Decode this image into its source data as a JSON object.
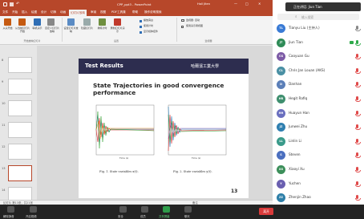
{
  "window": {
    "title": "CPP_ppt3 - PowerPoint",
    "user": "Hall Jiten",
    "share_badge": "正在讲话: Jiun Tian"
  },
  "ribbon": {
    "tabs": [
      "文件",
      "开始",
      "插入",
      "绘图",
      "设计",
      "切换",
      "动画",
      "幻灯片放映",
      "审阅",
      "视图",
      "PDF工具集",
      "帮助",
      "操作说明搜索"
    ],
    "active_tab": "幻灯片放映",
    "buttons": [
      "从头开始",
      "从当前幻灯片开始",
      "联机演示",
      "自定义幻灯片放映",
      "设置幻灯片放映",
      "隐藏幻灯片",
      "排练计时",
      "录制幻灯片演示"
    ],
    "checkboxes": [
      "播放旁白",
      "使用计时",
      "显示媒体控件"
    ],
    "monitor_label": "监视器: 自动",
    "presenter_view": "使用演示者视图",
    "groups": [
      "开始放映幻灯片",
      "设置",
      "监视器"
    ]
  },
  "thumbnails": [
    "8",
    "9",
    "10",
    "11",
    "12",
    "13",
    "14"
  ],
  "slide": {
    "header": "Test Results",
    "university": "哈爾濱工業大學",
    "title": "State Trajectories in good convergence performance",
    "caption1": "Fig. 1. State variables x(t).",
    "caption2": "Fig. 2. State variables y(t).",
    "axis_label1": "Time (s)",
    "axis_label2": "Time (s)",
    "page_number": "13"
  },
  "statusbar": {
    "left": "幻灯片 第13张，共21张",
    "right": "备注"
  },
  "sidebar": {
    "search_placeholder": "输入搜索",
    "participants": [
      {
        "initials": "TL",
        "name": "Tianyu Liu (主持人)",
        "color": "#3a7bd5",
        "mic": "on"
      },
      {
        "initials": "JT",
        "name": "Jiun Tian",
        "color": "#2e8b57",
        "mic": "active"
      },
      {
        "initials": "CG",
        "name": "Caoyuan Gu",
        "color": "#7d5ba6",
        "mic": "off"
      },
      {
        "initials": "CL",
        "name": "Chris Jan Louan (AKS)",
        "color": "#4a90a4",
        "mic": "off"
      },
      {
        "initials": "D",
        "name": "Danhan",
        "color": "#5b7fb8",
        "mic": "off"
      },
      {
        "initials": "HR",
        "name": "Hegit Rafiq",
        "color": "#3f8f6f",
        "mic": "off"
      },
      {
        "initials": "HH",
        "name": "Huayun Han",
        "color": "#6a6fbf",
        "mic": "off"
      },
      {
        "initials": "JZ",
        "name": "Junwei Zhu",
        "color": "#2f7fb0",
        "mic": "off"
      },
      {
        "initials": "LL",
        "name": "Linlin Li",
        "color": "#3a9a8a",
        "mic": "off"
      },
      {
        "initials": "S",
        "name": "Steven",
        "color": "#4b6fbf",
        "mic": "off"
      },
      {
        "initials": "XX",
        "name": "Xiaoyi Xu",
        "color": "#3c8f5a",
        "mic": "off"
      },
      {
        "initials": "Y",
        "name": "Yuchen",
        "color": "#6a5fb0",
        "mic": "off"
      },
      {
        "initials": "ZZ",
        "name": "Zhenjin Zhao",
        "color": "#2e7fa8",
        "mic": "off"
      }
    ],
    "buttons": [
      "邀请",
      "静音全体",
      "更多"
    ]
  },
  "bottom": {
    "left": [
      "解除静音",
      "开启视频"
    ],
    "center": [
      "安全",
      "成员",
      "共享屏幕",
      "聊天"
    ],
    "end": "离开"
  }
}
